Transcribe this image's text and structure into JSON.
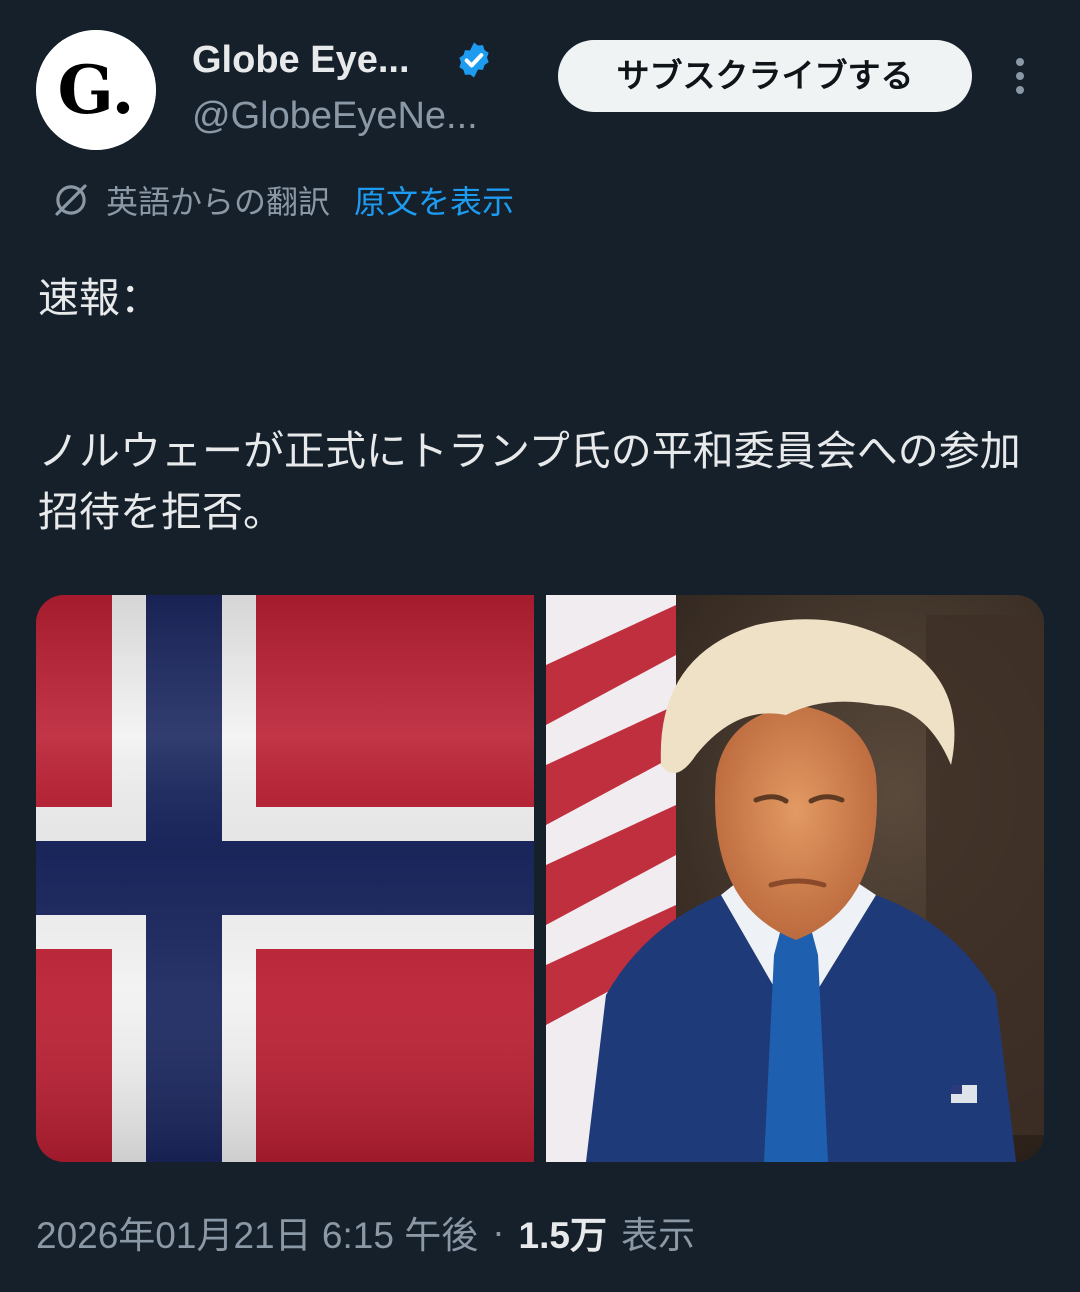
{
  "author": {
    "avatar_letter": "G.",
    "display_name": "Globe Eye...",
    "handle": "@GlobeEyeNe..."
  },
  "header": {
    "subscribe_label": "サブスクライブする"
  },
  "translation": {
    "note": "英語からの翻訳",
    "show_original_label": "原文を表示"
  },
  "tweet": {
    "line1": "速報：",
    "line2": "ノルウェーが正式にトランプ氏の平和委員会への参加招待を拒否。"
  },
  "meta": {
    "timestamp": "2026年01月21日 6:15 午後",
    "separator": "·",
    "view_count": "1.5万",
    "view_label": "表示"
  },
  "colors": {
    "background": "#15202b",
    "verified_blue": "#1d9bf0",
    "link_blue": "#1d9bf0",
    "flag_red": "#ba1f33",
    "flag_blue": "#1b275f"
  },
  "icons": {
    "verified": "verified-badge-icon",
    "translate": "translate-icon",
    "more": "more-vertical-icon"
  }
}
